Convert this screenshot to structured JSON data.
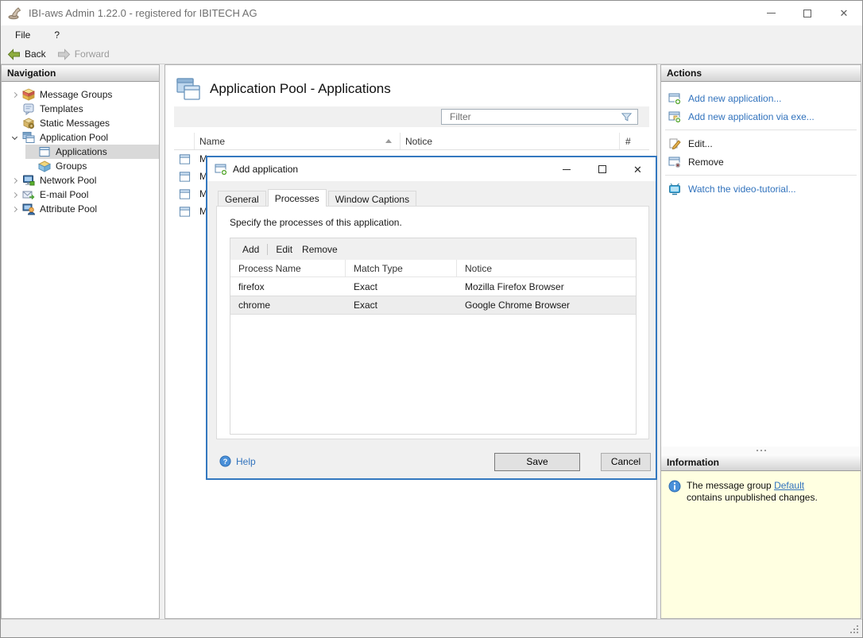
{
  "window": {
    "title": "IBI-aws Admin 1.22.0 - registered for IBITECH AG"
  },
  "menu": {
    "file": "File",
    "help": "?"
  },
  "toolbar": {
    "back": "Back",
    "forward": "Forward"
  },
  "navigation": {
    "header": "Navigation",
    "items": [
      {
        "label": "Message Groups",
        "icon": "message-groups-icon",
        "chevron": "collapsed",
        "depth": 0,
        "selected": false
      },
      {
        "label": "Templates",
        "icon": "templates-icon",
        "chevron": "none",
        "depth": 0,
        "selected": false
      },
      {
        "label": "Static Messages",
        "icon": "static-messages-icon",
        "chevron": "none",
        "depth": 0,
        "selected": false
      },
      {
        "label": "Application Pool",
        "icon": "application-pool-icon",
        "chevron": "expanded",
        "depth": 0,
        "selected": false
      },
      {
        "label": "Applications",
        "icon": "applications-icon",
        "chevron": "none",
        "depth": 1,
        "selected": true
      },
      {
        "label": "Groups",
        "icon": "groups-icon",
        "chevron": "none",
        "depth": 1,
        "selected": false
      },
      {
        "label": "Network Pool",
        "icon": "network-pool-icon",
        "chevron": "collapsed",
        "depth": 0,
        "selected": false
      },
      {
        "label": "E-mail Pool",
        "icon": "email-pool-icon",
        "chevron": "collapsed",
        "depth": 0,
        "selected": false
      },
      {
        "label": "Attribute Pool",
        "icon": "attribute-pool-icon",
        "chevron": "collapsed",
        "depth": 0,
        "selected": false
      }
    ]
  },
  "content": {
    "title": "Application Pool - Applications",
    "filter_placeholder": "Filter",
    "table": {
      "columns": [
        "Name",
        "Notice",
        "#"
      ],
      "sort": {
        "column": "Name",
        "direction": "asc"
      },
      "rows": [
        "M",
        "M",
        "M",
        "M"
      ]
    }
  },
  "actions": {
    "header": "Actions",
    "items": [
      {
        "label": "Add new application...",
        "icon": "add-application-icon",
        "style": "link"
      },
      {
        "label": "Add new application via exe...",
        "icon": "add-application-exe-icon",
        "style": "link"
      },
      {
        "label": "Edit...",
        "icon": "edit-icon",
        "style": "normal"
      },
      {
        "label": "Remove",
        "icon": "remove-icon",
        "style": "normal"
      },
      {
        "label": "Watch the video-tutorial...",
        "icon": "video-tutorial-icon",
        "style": "link"
      }
    ]
  },
  "information": {
    "header": "Information",
    "text_before": "The message group ",
    "link_text": "Default",
    "text_after": " contains unpublished changes."
  },
  "dialog": {
    "title": "Add application",
    "tabs": [
      "General",
      "Processes",
      "Window Captions"
    ],
    "active_tab": "Processes",
    "description": "Specify the processes of this application.",
    "toolbar": {
      "add": "Add",
      "edit": "Edit",
      "remove": "Remove"
    },
    "table": {
      "columns": [
        "Process Name",
        "Match Type",
        "Notice"
      ],
      "rows": [
        [
          "firefox",
          "Exact",
          "Mozilla Firefox Browser"
        ],
        [
          "chrome",
          "Exact",
          "Google Chrome Browser"
        ]
      ],
      "selected_row": "chrome"
    },
    "help": "Help",
    "save": "Save",
    "cancel": "Cancel"
  },
  "colors": {
    "dialog_border": "#3478bf",
    "link_blue": "#3273bd",
    "info_background": "#ffffe1",
    "selection_gray": "#d9d9d9"
  }
}
